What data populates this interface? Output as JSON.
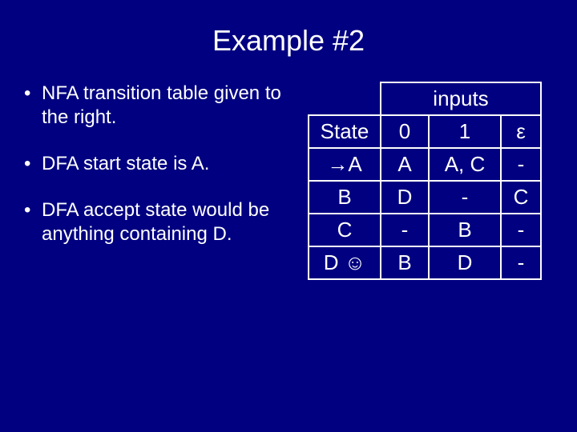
{
  "title": "Example #2",
  "bullets": [
    "NFA transition table given to the right.",
    "DFA start state is A.",
    "DFA accept state would be anything containing D."
  ],
  "table": {
    "inputs_header": "inputs",
    "state_header": "State",
    "col0": "0",
    "col1": "1",
    "cole": "ε",
    "rows": [
      {
        "state": "→A",
        "c0": "A",
        "c1": "A, C",
        "ce": "-"
      },
      {
        "state": "B",
        "c0": "D",
        "c1": "-",
        "ce": "C"
      },
      {
        "state": "C",
        "c0": "-",
        "c1": "B",
        "ce": "-"
      },
      {
        "state": "D ☺",
        "c0": "B",
        "c1": "D",
        "ce": "-"
      }
    ]
  }
}
